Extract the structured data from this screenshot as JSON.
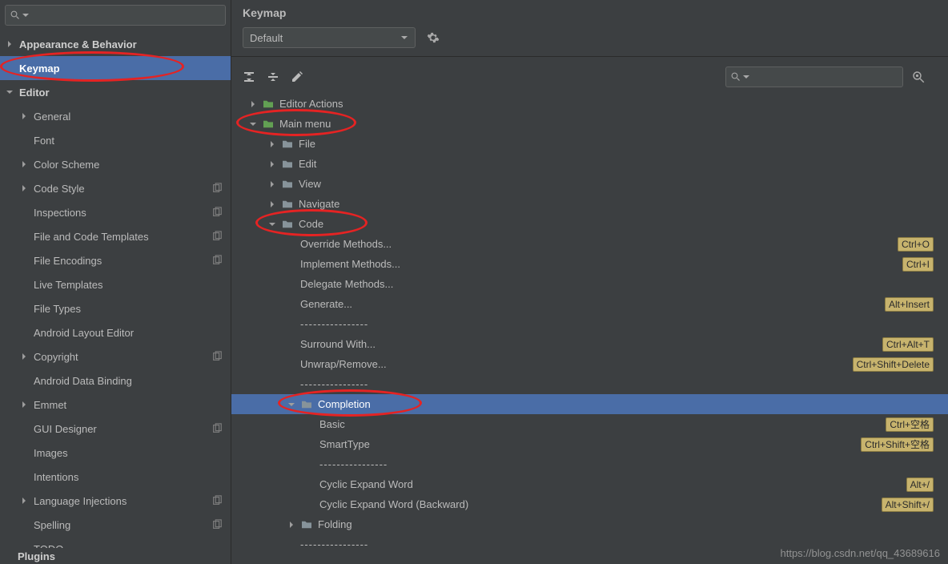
{
  "sidebar": {
    "items": [
      {
        "label": "Appearance & Behavior",
        "bold": true,
        "arrow": "right",
        "lvl": 0
      },
      {
        "label": "Keymap",
        "bold": true,
        "arrow": "none",
        "lvl": 0,
        "selected": true,
        "ring": true
      },
      {
        "label": "Editor",
        "bold": true,
        "arrow": "down",
        "lvl": 0
      },
      {
        "label": "General",
        "arrow": "right",
        "lvl": 1
      },
      {
        "label": "Font",
        "arrow": "none",
        "lvl": 1
      },
      {
        "label": "Color Scheme",
        "arrow": "right",
        "lvl": 1
      },
      {
        "label": "Code Style",
        "arrow": "right",
        "lvl": 1,
        "copy": true
      },
      {
        "label": "Inspections",
        "arrow": "none",
        "lvl": 1,
        "copy": true
      },
      {
        "label": "File and Code Templates",
        "arrow": "none",
        "lvl": 1,
        "copy": true
      },
      {
        "label": "File Encodings",
        "arrow": "none",
        "lvl": 1,
        "copy": true
      },
      {
        "label": "Live Templates",
        "arrow": "none",
        "lvl": 1
      },
      {
        "label": "File Types",
        "arrow": "none",
        "lvl": 1
      },
      {
        "label": "Android Layout Editor",
        "arrow": "none",
        "lvl": 1
      },
      {
        "label": "Copyright",
        "arrow": "right",
        "lvl": 1,
        "copy": true
      },
      {
        "label": "Android Data Binding",
        "arrow": "none",
        "lvl": 1
      },
      {
        "label": "Emmet",
        "arrow": "right",
        "lvl": 1
      },
      {
        "label": "GUI Designer",
        "arrow": "none",
        "lvl": 1,
        "copy": true
      },
      {
        "label": "Images",
        "arrow": "none",
        "lvl": 1
      },
      {
        "label": "Intentions",
        "arrow": "none",
        "lvl": 1
      },
      {
        "label": "Language Injections",
        "arrow": "right",
        "lvl": 1,
        "copy": true
      },
      {
        "label": "Spelling",
        "arrow": "none",
        "lvl": 1,
        "copy": true
      },
      {
        "label": "TODO",
        "arrow": "none",
        "lvl": 1
      }
    ],
    "plugins_label": "Plugins"
  },
  "main": {
    "title": "Keymap",
    "scheme": "Default",
    "tree": [
      {
        "label": "Editor Actions",
        "arrow": "right",
        "lvl": 0,
        "folder": "green"
      },
      {
        "label": "Main menu",
        "arrow": "down",
        "lvl": 0,
        "folder": "green",
        "ring": true
      },
      {
        "label": "File",
        "arrow": "right",
        "lvl": 1,
        "folder": "gray"
      },
      {
        "label": "Edit",
        "arrow": "right",
        "lvl": 1,
        "folder": "gray"
      },
      {
        "label": "View",
        "arrow": "right",
        "lvl": 1,
        "folder": "gray"
      },
      {
        "label": "Navigate",
        "arrow": "right",
        "lvl": 1,
        "folder": "gray"
      },
      {
        "label": "Code",
        "arrow": "down",
        "lvl": 1,
        "folder": "gray",
        "ring": true
      },
      {
        "label": "Override Methods...",
        "arrow": "none",
        "lvl": 2,
        "shortcut": "Ctrl+O"
      },
      {
        "label": "Implement Methods...",
        "arrow": "none",
        "lvl": 2,
        "shortcut": "Ctrl+I"
      },
      {
        "label": "Delegate Methods...",
        "arrow": "none",
        "lvl": 2
      },
      {
        "label": "Generate...",
        "arrow": "none",
        "lvl": 2,
        "shortcut": "Alt+Insert"
      },
      {
        "label": "----------------",
        "arrow": "none",
        "lvl": 2,
        "sep": true
      },
      {
        "label": "Surround With...",
        "arrow": "none",
        "lvl": 2,
        "shortcut": "Ctrl+Alt+T"
      },
      {
        "label": "Unwrap/Remove...",
        "arrow": "none",
        "lvl": 2,
        "shortcut": "Ctrl+Shift+Delete"
      },
      {
        "label": "----------------",
        "arrow": "none",
        "lvl": 2,
        "sep": true
      },
      {
        "label": "Completion",
        "arrow": "down",
        "lvl": 2,
        "folder": "gray",
        "selected": true,
        "ring": true
      },
      {
        "label": "Basic",
        "arrow": "none",
        "lvl": 3,
        "shortcut": "Ctrl+空格"
      },
      {
        "label": "SmartType",
        "arrow": "none",
        "lvl": 3,
        "shortcut": "Ctrl+Shift+空格"
      },
      {
        "label": "----------------",
        "arrow": "none",
        "lvl": 3,
        "sep": true
      },
      {
        "label": "Cyclic Expand Word",
        "arrow": "none",
        "lvl": 3,
        "shortcut": "Alt+/"
      },
      {
        "label": "Cyclic Expand Word (Backward)",
        "arrow": "none",
        "lvl": 3,
        "shortcut": "Alt+Shift+/"
      },
      {
        "label": "Folding",
        "arrow": "right",
        "lvl": 2,
        "folder": "gray"
      },
      {
        "label": "----------------",
        "arrow": "none",
        "lvl": 2,
        "sep": true
      }
    ],
    "watermark": "https://blog.csdn.net/qq_43689616"
  }
}
